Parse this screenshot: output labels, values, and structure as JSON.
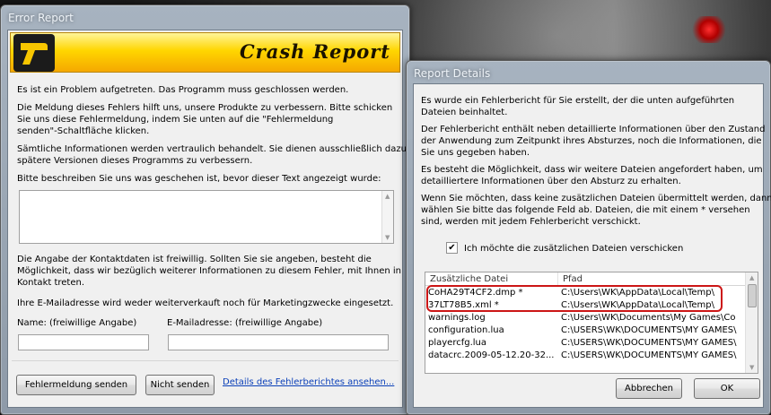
{
  "error_report": {
    "window_title": "Error Report",
    "banner_title": "Crash Report",
    "paragraphs": {
      "p1": "Es ist ein Problem aufgetreten. Das Programm muss geschlossen werden.",
      "p2_line1": "Die Meldung dieses Fehlers hilft uns, unsere Produkte zu verbessern. Bitte schicken",
      "p2_line2": "Sie uns diese Fehlermeldung, indem Sie unten auf die \"Fehlermeldung",
      "p2_line3": "senden\"-Schaltfläche klicken.",
      "p3_line1": "Sämtliche Informationen werden vertraulich behandelt. Sie dienen ausschließlich dazu,",
      "p3_line2": "spätere Versionen dieses Programms zu verbessern.",
      "p4": "Bitte beschreiben Sie uns was geschehen ist, bevor dieser Text angezeigt wurde:",
      "p5_line1": "Die Angabe der Kontaktdaten ist freiwillig. Sollten Sie sie angeben, besteht die",
      "p5_line2": "Möglichkeit, dass wir bezüglich weiterer Informationen zu diesem Fehler, mit Ihnen in",
      "p5_line3": "Kontakt treten.",
      "p6": "Ihre E-Mailadresse wird weder weiterverkauft noch für Marketingzwecke eingesetzt."
    },
    "description_value": "",
    "name_label": "Name: (freiwillige Angabe)",
    "name_value": "",
    "email_label": "E-Mailadresse: (freiwillige Angabe)",
    "email_value": "",
    "send_button": "Fehlermeldung senden",
    "dont_send_button": "Nicht senden",
    "details_link": "Details des Fehlerberichtes ansehen..."
  },
  "report_details": {
    "window_title": "Report Details",
    "paragraphs": {
      "p1_line1": "Es wurde ein Fehlerbericht für Sie erstellt, der die unten aufgeführten",
      "p1_line2": "Dateien beinhaltet.",
      "p2_line1": "Der Fehlerbericht enthält neben detaillierte Informationen über den Zustand",
      "p2_line2": "der Anwendung zum Zeitpunkt ihres Absturzes, noch die Informationen, die",
      "p2_line3": "Sie uns gegeben haben.",
      "p3_line1": "Es besteht die Möglichkeit, dass wir weitere Dateien angefordert haben, um",
      "p3_line2": "detailliertere Informationen über den Absturz zu erhalten.",
      "p4_line1": "Wenn Sie möchten, dass keine zusätzlichen Dateien übermittelt werden, dann",
      "p4_line2": "wählen Sie bitte das folgende Feld ab.  Dateien, die mit einem * versehen",
      "p4_line3": "sind, werden mit jedem Fehlerbericht verschickt."
    },
    "checkbox_label": "Ich möchte die zusätzlichen Dateien verschicken",
    "checkbox_checked": true,
    "checkmark": "✔",
    "columns": [
      "Zusätzliche Datei",
      "Pfad"
    ],
    "files": [
      {
        "name": "CoHA29T4CF2.dmp *",
        "path": "C:\\Users\\WK\\AppData\\Local\\Temp\\"
      },
      {
        "name": "37LT78B5.xml *",
        "path": "C:\\Users\\WK\\AppData\\Local\\Temp\\"
      },
      {
        "name": "warnings.log",
        "path": "C:\\Users\\WK\\Documents\\My Games\\Co"
      },
      {
        "name": "configuration.lua",
        "path": "C:\\USERS\\WK\\DOCUMENTS\\MY GAMES\\"
      },
      {
        "name": "playercfg.lua",
        "path": "C:\\USERS\\WK\\DOCUMENTS\\MY GAMES\\"
      },
      {
        "name": "datacrc.2009-05-12.20-32...",
        "path": "C:\\USERS\\WK\\DOCUMENTS\\MY GAMES\\"
      }
    ],
    "cancel_button": "Abbrechen",
    "ok_button": "OK"
  },
  "colors": {
    "highlight": "#cc1616",
    "link": "#0a3fb8",
    "banner": "#ffd600"
  }
}
